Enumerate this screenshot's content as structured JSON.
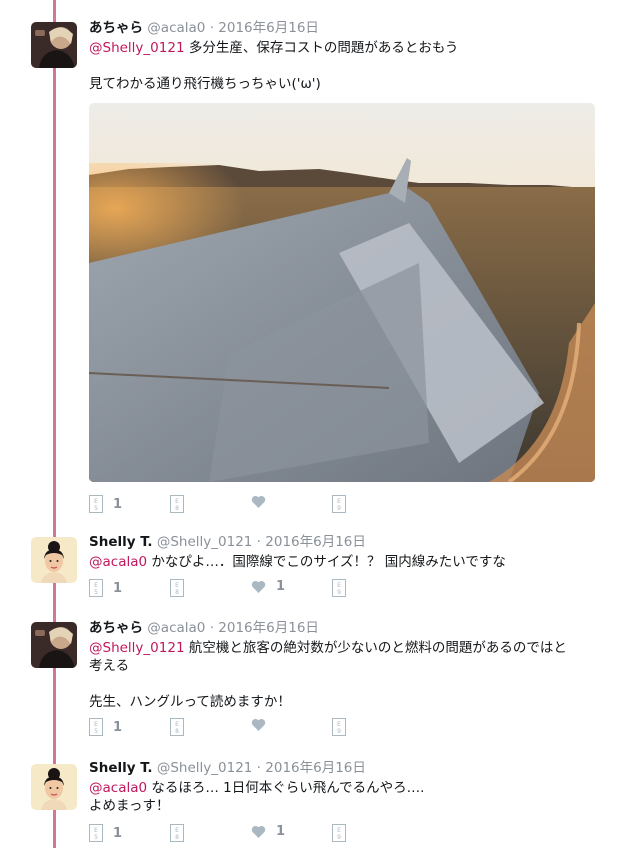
{
  "tweets": [
    {
      "name": "あちゃら",
      "handle": "@acala0",
      "date": "2016年6月16日",
      "mention": "@Shelly_0121",
      "text": " 多分生産、保存コストの問題があるとおもう",
      "text2": "見てわかる通り飛行機ちっちゃい('ω')",
      "replies": "1"
    },
    {
      "name": "Shelly T.",
      "handle": "@Shelly_0121",
      "date": "2016年6月16日",
      "mention": "@acala0",
      "text": " かなぴよ…．国際線でこのサイズ！？ 国内線みたいですな",
      "replies": "1",
      "likes": "1"
    },
    {
      "name": "あちゃら",
      "handle": "@acala0",
      "date": "2016年6月16日",
      "mention": "@Shelly_0121",
      "text": " 航空機と旅客の絶対数が少ないのと燃料の問題があるのではと",
      "text_cont": "考える",
      "text2": "先生、ハングルって読めますか！",
      "replies": "1"
    },
    {
      "name": "Shelly T.",
      "handle": "@Shelly_0121",
      "date": "2016年6月16日",
      "mention": "@acala0",
      "text": " なるほろ… 1日何本ぐらい飛んでるんやろ….",
      "text_cont": "よめまっす！",
      "replies": "1",
      "likes": "1"
    }
  ],
  "separator": "·",
  "icons": {
    "reply": "reply-icon",
    "retweet": "retweet-icon",
    "like": "heart-icon",
    "dm": "direct-message-icon"
  }
}
